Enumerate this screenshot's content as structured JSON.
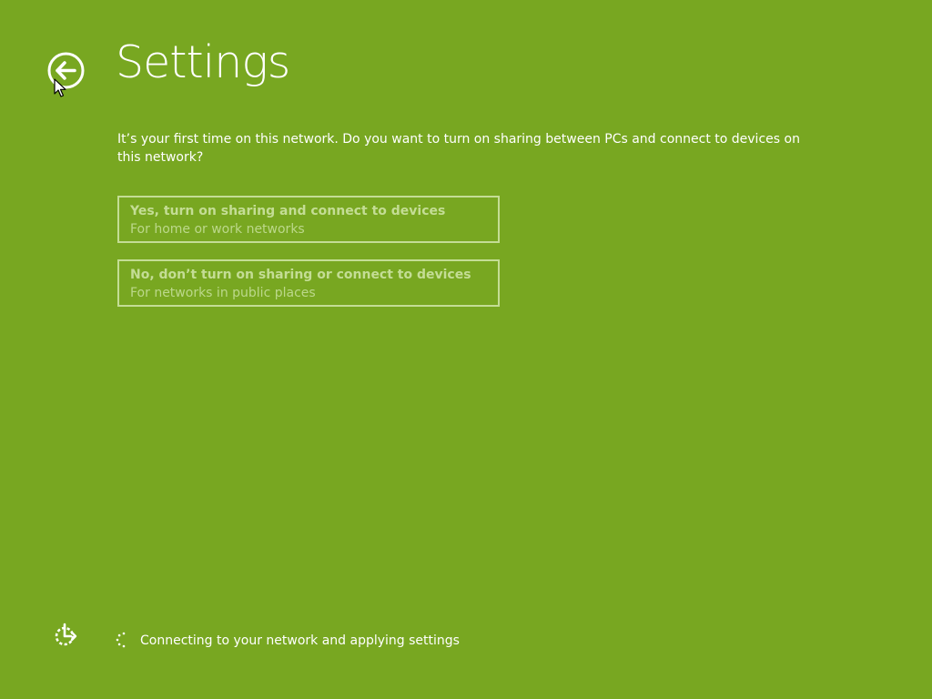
{
  "colors": {
    "background": "#78a721",
    "text": "#ffffff",
    "option_border": "#c4dd95",
    "option_text": "#c4dd95"
  },
  "header": {
    "back_icon": "back-arrow-circle-icon",
    "title": "Settings"
  },
  "prompt": "It’s your first time on this network. Do you want to turn on sharing between PCs and connect to devices on this network?",
  "options": [
    {
      "title": "Yes, turn on sharing and connect to devices",
      "subtitle": "For home or work networks"
    },
    {
      "title": "No, don’t turn on sharing or connect to devices",
      "subtitle": "For networks in public places"
    }
  ],
  "footer": {
    "ease_of_access_icon": "ease-of-access-icon",
    "spinner_icon": "loading-spinner-icon",
    "status": "Connecting to your network and applying settings"
  }
}
